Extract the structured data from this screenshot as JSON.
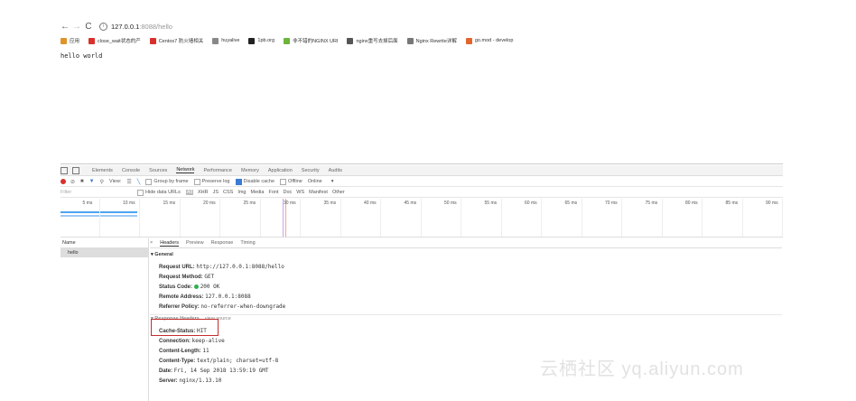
{
  "browser": {
    "url_host": "127.0.0.1",
    "url_path": ":8088/hello",
    "bookmarks": [
      {
        "label": "应用",
        "icon": "apps-grid-icon",
        "color": "#e0932b"
      },
      {
        "label": "close_wait状态的产",
        "icon": "c-logo-icon",
        "color": "#d9302c"
      },
      {
        "label": "Centos7 防火墙相关",
        "icon": "c-logo-icon",
        "color": "#d9302c"
      },
      {
        "label": "huyalive",
        "icon": "page-icon",
        "color": "#888888"
      },
      {
        "label": "1pb.org",
        "icon": "github-icon",
        "color": "#222222"
      },
      {
        "label": "非不错的NGINX URI",
        "icon": "bookmark-green-icon",
        "color": "#6bb53a"
      },
      {
        "label": "nginx重写去掉后面",
        "icon": "nginx-icon",
        "color": "#555555"
      },
      {
        "label": "Nginx Rewrite详解",
        "icon": "rewrite-icon",
        "color": "#777777"
      },
      {
        "label": "go.mod - develop",
        "icon": "gitlab-fox-icon",
        "color": "#e2652c"
      }
    ]
  },
  "page": {
    "content_text": "hello world"
  },
  "devtools": {
    "tabs": [
      "Elements",
      "Console",
      "Sources",
      "Network",
      "Performance",
      "Memory",
      "Application",
      "Security",
      "Audits"
    ],
    "active_tab": "Network",
    "toolbar": {
      "view_label": "View:",
      "group_by_frame": "Group by frame",
      "preserve_log": "Preserve log",
      "disable_cache": "Disable cache",
      "offline": "Offline",
      "online": "Online"
    },
    "filter": {
      "placeholder": "Filter",
      "hide_data_urls": "Hide data URLs",
      "types": [
        "All",
        "XHR",
        "JS",
        "CSS",
        "Img",
        "Media",
        "Font",
        "Doc",
        "WS",
        "Manifest",
        "Other"
      ],
      "selected_type": "All"
    },
    "timeline_ticks": [
      "5 ms",
      "10 ms",
      "15 ms",
      "20 ms",
      "25 ms",
      "30 ms",
      "35 ms",
      "40 ms",
      "45 ms",
      "50 ms",
      "55 ms",
      "60 ms",
      "65 ms",
      "70 ms",
      "75 ms",
      "80 ms",
      "85 ms",
      "90 ms"
    ],
    "name_column_header": "Name",
    "requests": [
      "hello"
    ],
    "detail_tabs": [
      "×",
      "Headers",
      "Preview",
      "Response",
      "Timing"
    ],
    "active_detail_tab": "Headers",
    "general_title": "▾ General",
    "general": [
      {
        "key": "Request URL:",
        "value": "http://127.0.0.1:8088/hello"
      },
      {
        "key": "Request Method:",
        "value": "GET"
      },
      {
        "key": "Status Code:",
        "value": "200 OK",
        "status_color": "#2bb24c"
      },
      {
        "key": "Remote Address:",
        "value": "127.0.0.1:8088"
      },
      {
        "key": "Referrer Policy:",
        "value": "no-referrer-when-downgrade"
      }
    ],
    "response_headers_title": "▾ Response Headers",
    "view_source": "view source",
    "response_headers": [
      {
        "key": "Cache-Status:",
        "value": "HIT"
      },
      {
        "key": "Connection:",
        "value": "keep-alive"
      },
      {
        "key": "Content-Length:",
        "value": "11"
      },
      {
        "key": "Content-Type:",
        "value": "text/plain; charset=utf-8"
      },
      {
        "key": "Date:",
        "value": "Fri, 14 Sep 2018 13:59:19 GMT"
      },
      {
        "key": "Server:",
        "value": "nginx/1.13.10"
      }
    ]
  },
  "watermark": "云栖社区 yq.aliyun.com",
  "colors": {
    "record": "#d9302c",
    "highlight": "#c52c2c",
    "status_ok": "#2bb24c",
    "accent": "#3a7bd5"
  }
}
